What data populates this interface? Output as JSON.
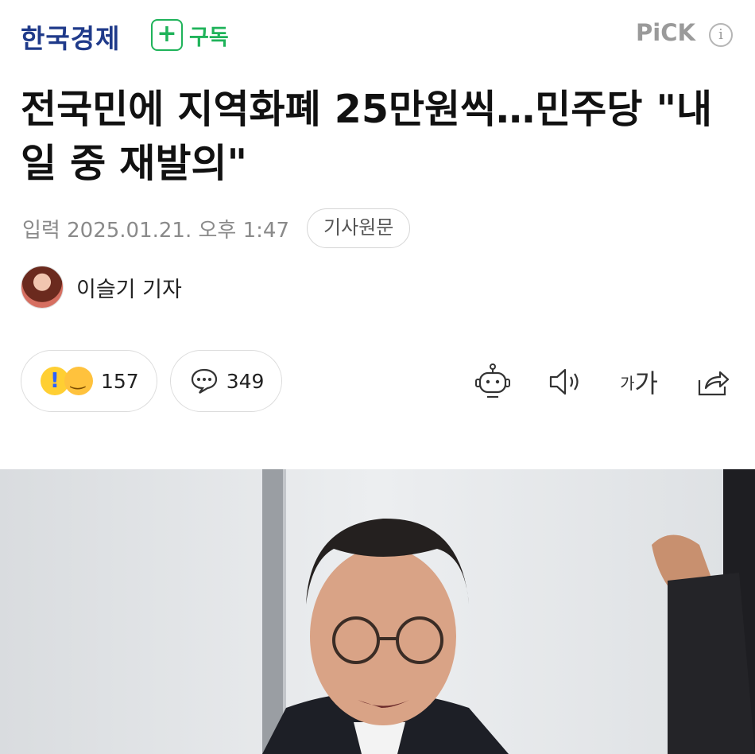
{
  "header": {
    "press_name": "한국경제",
    "subscribe_plus": "+",
    "subscribe_label": "구독",
    "pick_label": "PiCK",
    "info_label": "i"
  },
  "article": {
    "headline": "전국민에 지역화폐 25만원씩…민주당 \"내일 중 재발의\"",
    "published": "입력 2025.01.21. 오후 1:47",
    "original_button": "기사원문",
    "author": "이슬기 기자"
  },
  "reactions": {
    "emotion_count": "157",
    "comment_count": "349"
  },
  "tools": {
    "font_small": "가",
    "font_large": "가"
  },
  "icons": [
    "plus-icon",
    "info-icon",
    "surprise-emoji-icon",
    "smile-emoji-icon",
    "comment-bubble-icon",
    "robot-summary-icon",
    "speaker-icon",
    "font-size-icon",
    "share-icon"
  ],
  "colors": {
    "press_blue": "#1f3a8a",
    "subscribe_green": "#1fb35a",
    "meta_gray": "#8a8a8a"
  }
}
